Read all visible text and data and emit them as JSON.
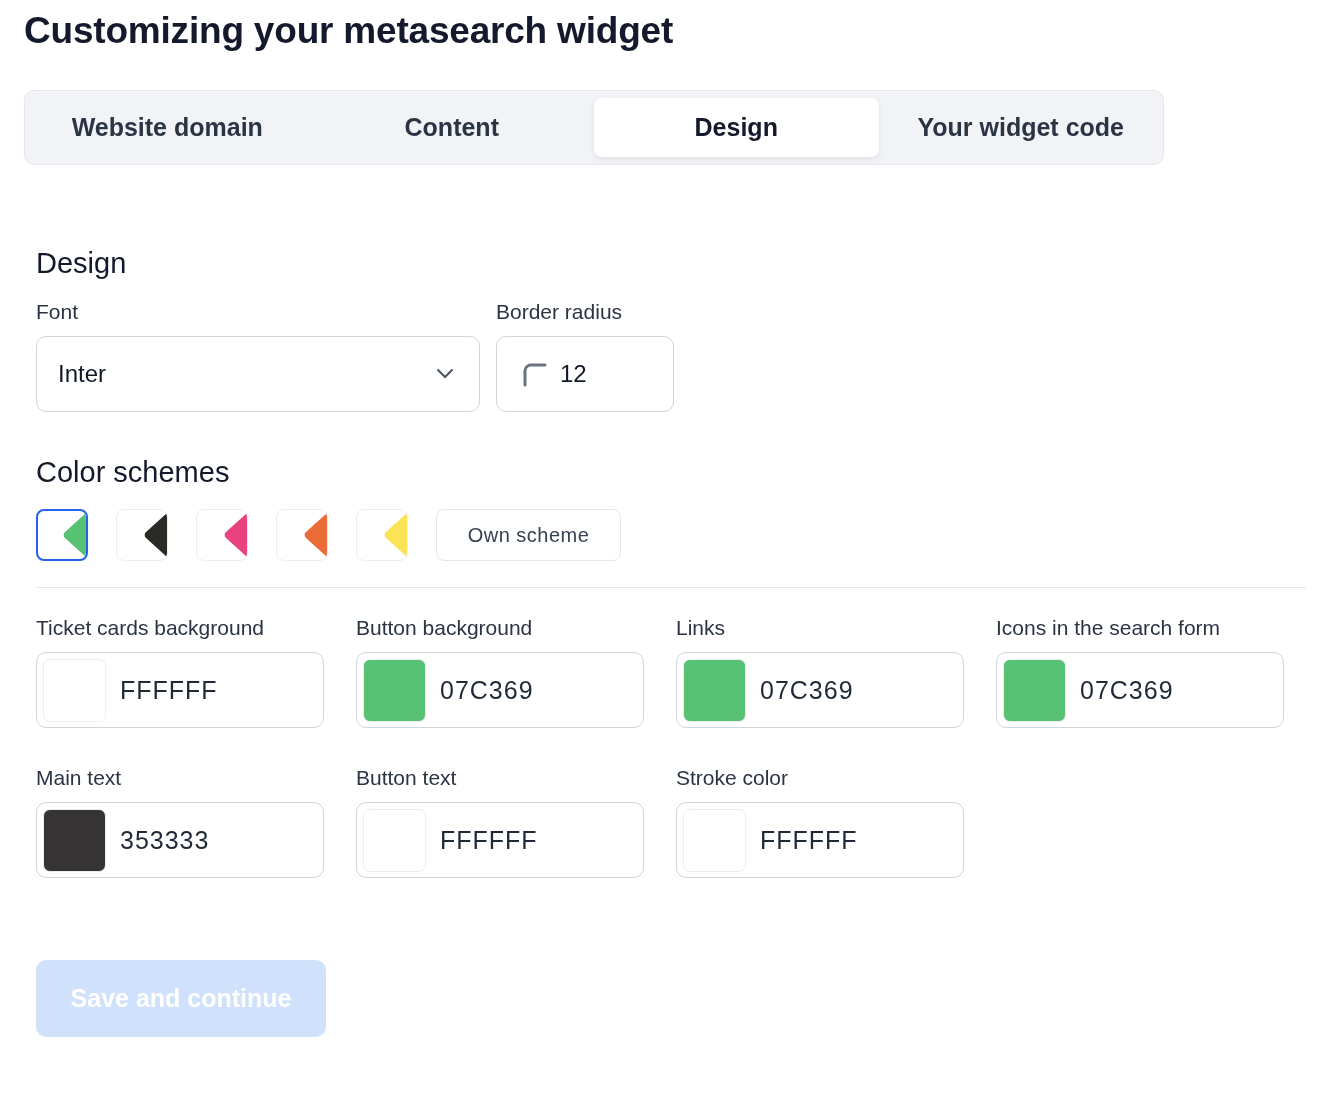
{
  "title": "Customizing your metasearch widget",
  "tabs": [
    {
      "label": "Website domain",
      "selected": false
    },
    {
      "label": "Content",
      "selected": false
    },
    {
      "label": "Design",
      "selected": true
    },
    {
      "label": "Your widget code",
      "selected": false
    }
  ],
  "design": {
    "heading": "Design",
    "font": {
      "label": "Font",
      "value": "Inter"
    },
    "border_radius": {
      "label": "Border radius",
      "value": "12"
    }
  },
  "color_schemes": {
    "heading": "Color schemes",
    "schemes": [
      {
        "color": "#57c174",
        "selected": true
      },
      {
        "color": "#2c2a27",
        "selected": false
      },
      {
        "color": "#e8437f",
        "selected": false
      },
      {
        "color": "#ec6c39",
        "selected": false
      },
      {
        "color": "#fbe356",
        "selected": false
      }
    ],
    "own_scheme": "Own scheme"
  },
  "color_fields": [
    {
      "label": "Ticket cards background",
      "value": "FFFFFF",
      "color": "#ffffff"
    },
    {
      "label": "Button background",
      "value": "07C369",
      "color": "#57c174"
    },
    {
      "label": "Links",
      "value": "07C369",
      "color": "#57c174"
    },
    {
      "label": "Icons in the search form",
      "value": "07C369",
      "color": "#57c174"
    },
    {
      "label": "Main text",
      "value": "353333",
      "color": "#353333"
    },
    {
      "label": "Button text",
      "value": "FFFFFF",
      "color": "#ffffff"
    },
    {
      "label": "Stroke color",
      "value": "FFFFFF",
      "color": "#ffffff"
    }
  ],
  "save_button": {
    "label": "Save and continue",
    "disabled": true
  }
}
